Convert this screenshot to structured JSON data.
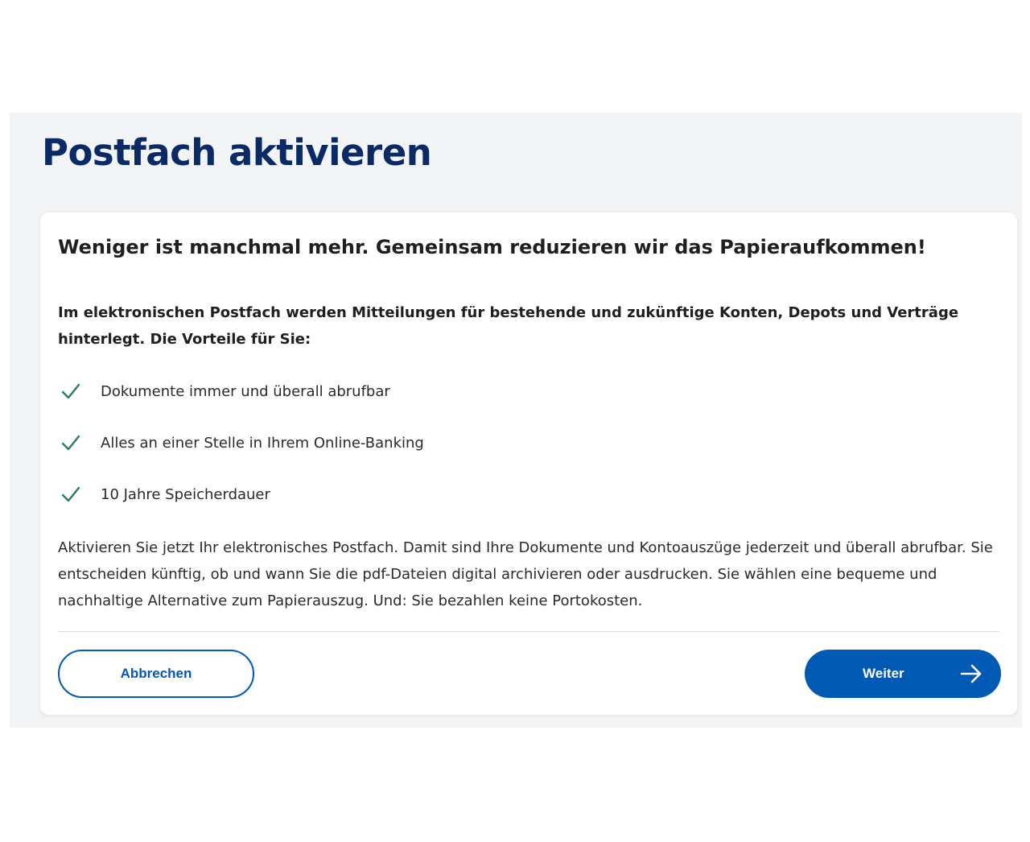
{
  "page": {
    "title": "Postfach aktivieren"
  },
  "card": {
    "headline": "Weniger ist manchmal mehr. Gemeinsam reduzieren wir das Papieraufkommen!",
    "intro": "Im elektronischen Postfach werden Mitteilungen für bestehende und zukünftige Konten, Depots und Verträge hinterlegt. Die Vorteile für Sie:",
    "benefits": [
      {
        "icon": "check-icon",
        "label": "Dokumente immer und überall abrufbar"
      },
      {
        "icon": "check-icon",
        "label": "Alles an einer Stelle in Ihrem Online-Banking"
      },
      {
        "icon": "check-icon",
        "label": "10 Jahre Speicherdauer"
      }
    ],
    "body": "Aktivieren Sie jetzt Ihr elektronisches Postfach. Damit sind Ihre Dokumente und Kontoauszüge jederzeit und überall abrufbar. Sie entscheiden künftig, ob und wann Sie die pdf-Dateien digital archivieren oder ausdrucken. Sie wählen eine bequeme und nachhaltige Alternative zum Papierauszug. Und: Sie bezahlen keine Portokosten."
  },
  "actions": {
    "cancel_label": "Abbrechen",
    "next_label": "Weiter",
    "next_icon": "arrow-right-icon"
  },
  "colors": {
    "title": "#0a2a66",
    "primary": "#0059b3",
    "check": "#2e7d5b",
    "panel_bg": "#f3f4f6"
  }
}
